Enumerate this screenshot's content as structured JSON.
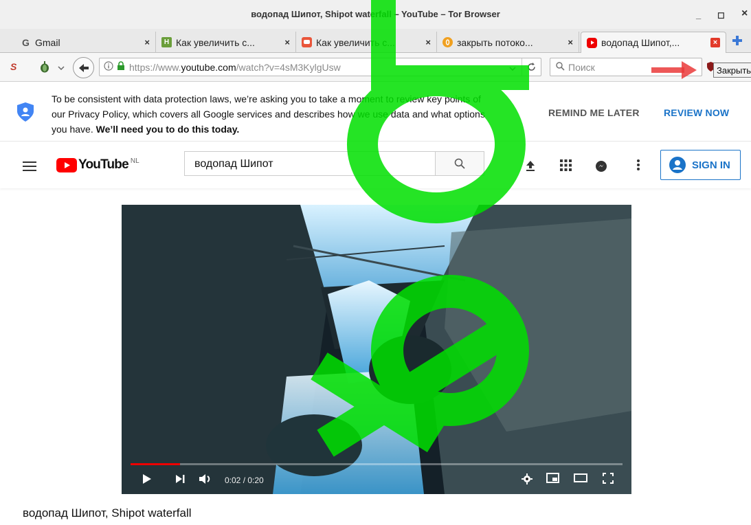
{
  "window": {
    "title": "водопад Шипот, Shipot waterfall – YouTube – Tor Browser",
    "minimize": "_",
    "maximize": "◻",
    "close": "×"
  },
  "tabs": [
    {
      "label": "Gmail",
      "favicon": "G",
      "close": "×"
    },
    {
      "label": "Как увеличить с...",
      "favicon": "H",
      "close": "×"
    },
    {
      "label": "Как увеличить с...",
      "favicon": "",
      "close": "×"
    },
    {
      "label": "закрыть потоко...",
      "favicon": "",
      "close": "×"
    },
    {
      "label": "водопад Шипот,...",
      "favicon": "",
      "close": "×",
      "active": true
    }
  ],
  "navbar": {
    "url_prefix": "https://www.",
    "url_domain": "youtube.com",
    "url_path": "/watch?v=4sM3KylgUsw",
    "search_placeholder": "Поиск",
    "tooltip": "Закрыть"
  },
  "privacy": {
    "line1": "To be consistent with data protection laws, we’re asking you to take a moment to review key points of",
    "line2": "our Privacy Policy, which covers all Google services and describes how we use data and what options",
    "line3_normal": "you have. ",
    "line3_bold": "We’ll need you to do this today.",
    "remind_label": "REMIND ME LATER",
    "review_label": "REVIEW NOW"
  },
  "youtube": {
    "logo_text": "YouTube",
    "region": "NL",
    "search_value": "водопад Шипот",
    "signin_label": "SIGN IN"
  },
  "video": {
    "time": "0:02 / 0:20",
    "progress_fraction": 0.1,
    "title": "водопад Шипот, Shipot waterfall"
  },
  "watermark": {
    "text": "doq"
  },
  "colors": {
    "yt_red": "#ff0000",
    "accent_blue": "#1a73c8",
    "watermark_green": "#00e000"
  }
}
